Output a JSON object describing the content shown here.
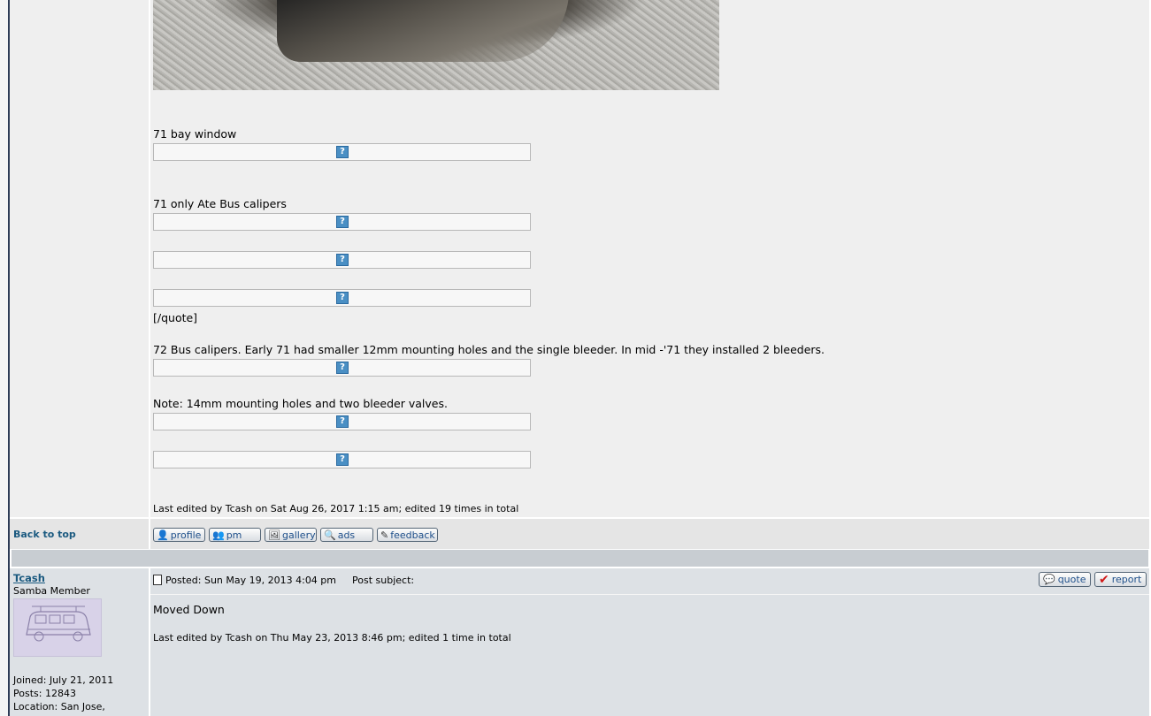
{
  "post1": {
    "captions": {
      "bay_window": "71 bay window",
      "ate_calipers": "71 only Ate Bus calipers",
      "quote_close": "[/quote]",
      "bus_calipers": "72 Bus calipers. Early 71 had smaller 12mm mounting holes and the single bleeder. In mid -'71 they installed 2 bleeders.",
      "note": "Note: 14mm mounting holes and two bleeder valves."
    },
    "placeholder_glyph": "?",
    "edited": "Last edited by Tcash on Sat Aug 26, 2017 1:15 am; edited 19 times in total"
  },
  "post_footer": {
    "back_to_top": "Back to top",
    "buttons": {
      "profile": "profile",
      "pm": "pm",
      "gallery": "gallery",
      "ads": "ads",
      "feedback": "feedback"
    }
  },
  "post2": {
    "author": {
      "username": "Tcash",
      "rank": "Samba Member",
      "joined": "Joined: July 21, 2011",
      "posts": "Posts: 12843",
      "location": "Location: San Jose,"
    },
    "posted": "Posted: Sun May 19, 2013 4:04 pm",
    "subject_label": "Post subject:",
    "buttons": {
      "quote": "quote",
      "report": "report"
    },
    "body": "Moved Down",
    "edited": "Last edited by Tcash on Thu May 23, 2013 8:46 pm; edited 1 time in total"
  }
}
